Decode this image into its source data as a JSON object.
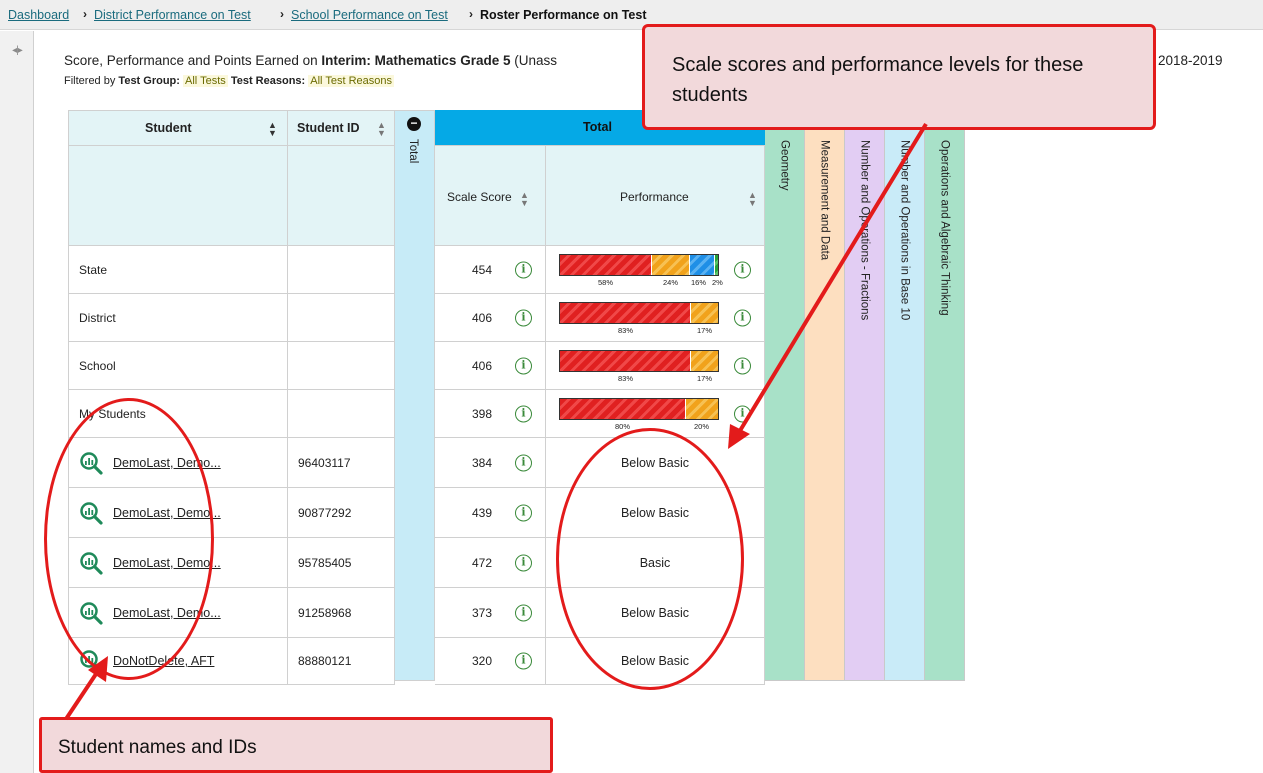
{
  "breadcrumb": {
    "items": [
      "Dashboard",
      "District Performance on Test",
      "School Performance on Test"
    ],
    "current": "Roster Performance on Test"
  },
  "report": {
    "title_prefix": "Score, Performance and Points Earned on ",
    "title_test": "Interim: Mathematics Grade 5",
    "title_suffix": " (Unass",
    "year": "2018-2019",
    "filter_group_label": "Test Group:",
    "filter_group_value": "All Tests",
    "filter_reasons_label": "Test Reasons:",
    "filter_reasons_value": "All Test Reasons",
    "filtered_by": "Filtered by"
  },
  "table": {
    "headers": {
      "student": "Student",
      "student_id": "Student ID",
      "total_vertical": "Total",
      "total_group": "Total",
      "scale_score": "Scale Score",
      "performance": "Performance"
    },
    "claims": [
      {
        "label": "Geometry",
        "color": "#a8e1c8"
      },
      {
        "label": "Measurement and Data",
        "color": "#fddfc0"
      },
      {
        "label": "Number and Operations - Fractions",
        "color": "#e2cdf3"
      },
      {
        "label": "Number and Operations in Base 10",
        "color": "#c9ebf8"
      },
      {
        "label": "Operations and Algebraic Thinking",
        "color": "#a8e1c8"
      }
    ],
    "aggregates": [
      {
        "label": "State",
        "scale_score": "454",
        "percents": [
          "58%",
          "24%",
          "16%",
          "2%"
        ],
        "fractions": [
          0.58,
          0.24,
          0.16,
          0.02
        ]
      },
      {
        "label": "District",
        "scale_score": "406",
        "percents": [
          "83%",
          "17%"
        ],
        "fractions": [
          0.83,
          0.17
        ]
      },
      {
        "label": "School",
        "scale_score": "406",
        "percents": [
          "83%",
          "17%"
        ],
        "fractions": [
          0.83,
          0.17
        ]
      },
      {
        "label": "My Students",
        "scale_score": "398",
        "percents": [
          "80%",
          "20%"
        ],
        "fractions": [
          0.8,
          0.2
        ]
      }
    ],
    "students": [
      {
        "name": "DemoLast, Demo...",
        "id": "96403117",
        "scale_score": "384",
        "performance": "Below Basic"
      },
      {
        "name": "DemoLast, Demo...",
        "id": "90877292",
        "scale_score": "439",
        "performance": "Below Basic"
      },
      {
        "name": "DemoLast, Demo...",
        "id": "95785405",
        "scale_score": "472",
        "performance": "Basic"
      },
      {
        "name": "DemoLast, Demo...",
        "id": "91258968",
        "scale_score": "373",
        "performance": "Below Basic"
      },
      {
        "name": "DoNotDelete, AFT",
        "id": "88880121",
        "scale_score": "320",
        "performance": "Below Basic"
      }
    ]
  },
  "callouts": {
    "top": "Scale scores and performance levels for these students",
    "bottom": "Student names and IDs"
  },
  "colors": {
    "callout_border": "#e31b1b",
    "callout_fill": "#f2d9db",
    "total_header": "#05a9e6",
    "level_1": "#e02020",
    "level_2": "#f1a21b",
    "level_3": "#1f8fe6",
    "level_4": "#27a33a"
  }
}
